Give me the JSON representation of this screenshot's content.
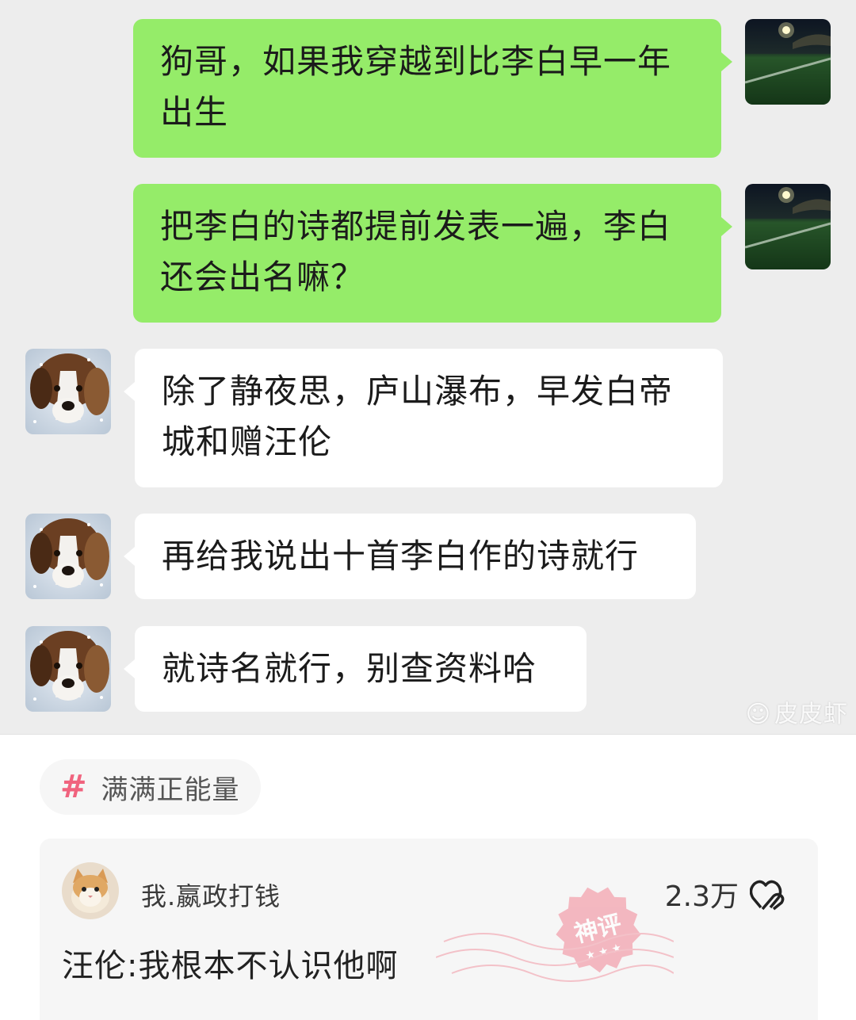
{
  "chat": {
    "messages": [
      {
        "sender": "me",
        "lines": [
          "狗哥，如果我穿越到比李白早一年",
          "出生"
        ]
      },
      {
        "sender": "me",
        "lines": [
          "把李白的诗都提前发表一遍，李白",
          "还会出名嘛？"
        ]
      },
      {
        "sender": "other",
        "lines": [
          "除了静夜思，庐山瀑布，早发白帝",
          "城和赠汪伦"
        ]
      },
      {
        "sender": "other",
        "lines": [
          "再给我说出十首李白作的诗就行"
        ]
      },
      {
        "sender": "other",
        "lines": [
          "就诗名就行，别查资料哈"
        ]
      }
    ],
    "watermark": "皮皮虾"
  },
  "tag": {
    "icon": "hash-icon",
    "label": "满满正能量"
  },
  "comment": {
    "username": "我.嬴政打钱",
    "likes": "2.3万",
    "text": "汪伦:我根本不认识他啊",
    "stamp_text": "神评"
  },
  "colors": {
    "my_bubble": "#95ec69",
    "other_bubble": "#ffffff",
    "chat_bg": "#ededed",
    "tag_hash": "#f0637e",
    "stamp": "#f3a3ae"
  }
}
